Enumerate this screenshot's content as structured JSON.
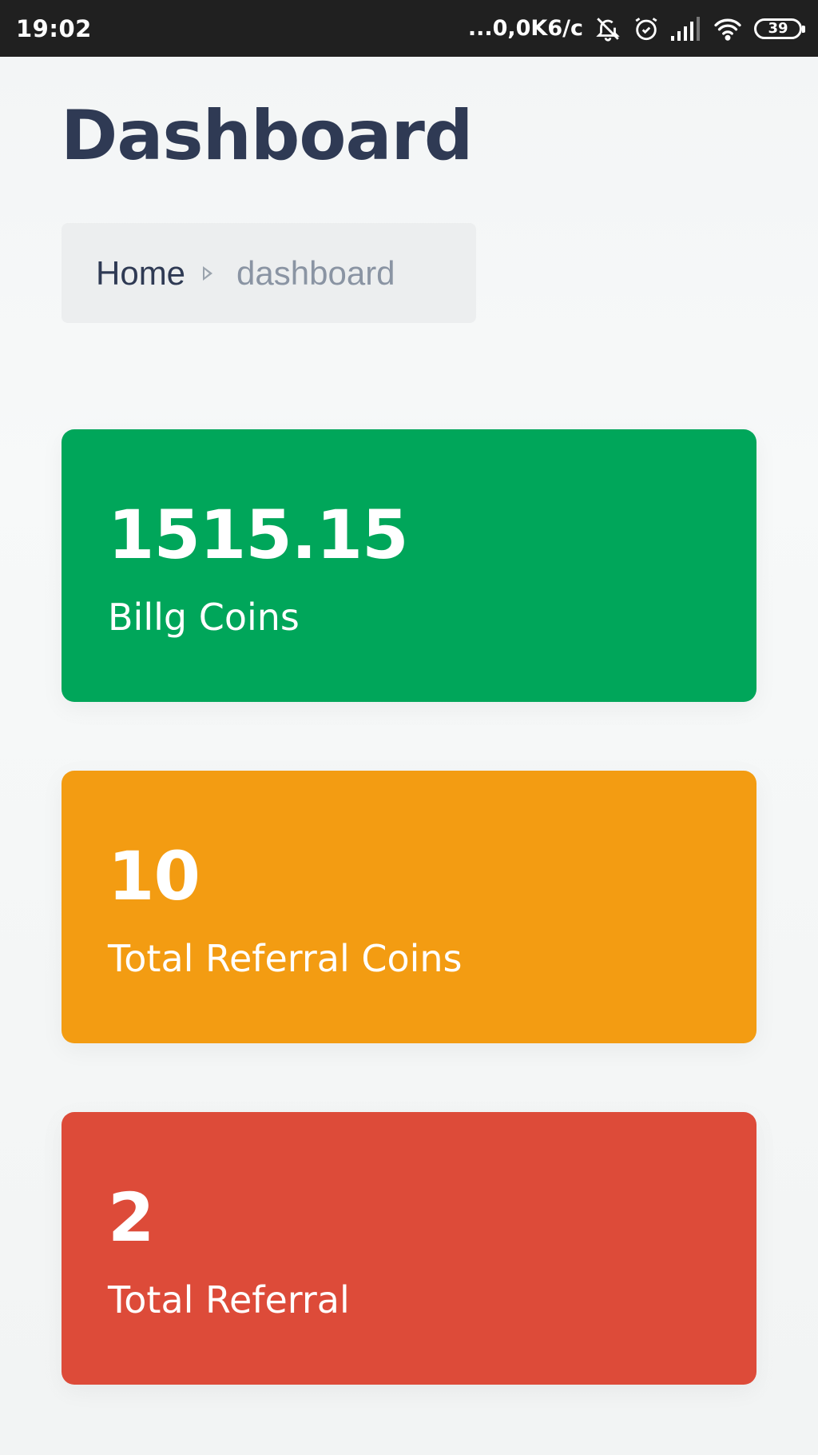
{
  "status_bar": {
    "time": "19:02",
    "network_speed": "...0,0K6/c",
    "battery": "39",
    "icons": [
      "bell-off-icon",
      "alarm-icon",
      "signal-icon",
      "wifi-icon",
      "battery-icon"
    ]
  },
  "page": {
    "title": "Dashboard"
  },
  "breadcrumb": {
    "home": "Home",
    "current": "dashboard"
  },
  "stats": [
    {
      "value": "1515.15",
      "label": "Billg Coins",
      "color": "#00a65a"
    },
    {
      "value": "10",
      "label": "Total Referral Coins",
      "color": "#f39c12"
    },
    {
      "value": "2",
      "label": "Total Referral",
      "color": "#dd4b39"
    }
  ]
}
